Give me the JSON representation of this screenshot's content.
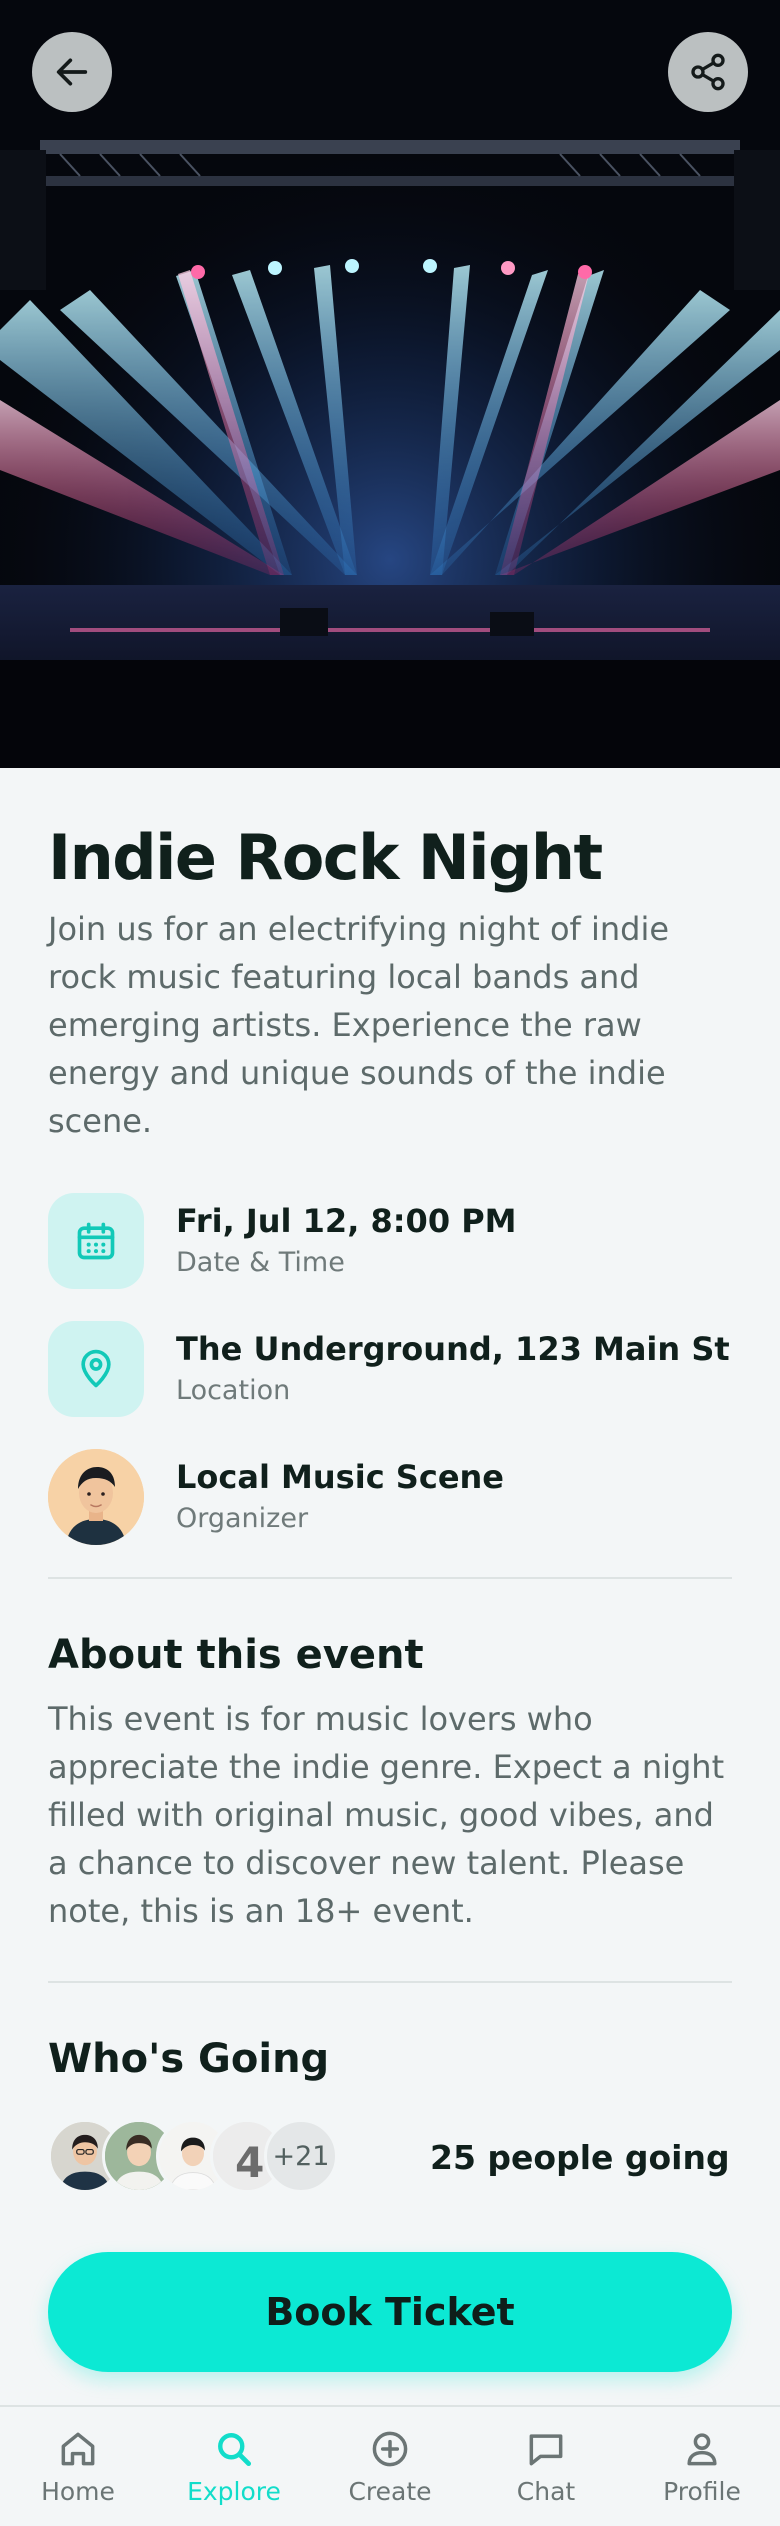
{
  "event": {
    "title": "Indie Rock Night",
    "description": "Join us for an electrifying night of indie rock music featuring local bands and emerging artists. Experience the raw energy and unique sounds of the indie scene."
  },
  "header": {
    "back_icon": "arrow-left-icon",
    "share_icon": "share-icon"
  },
  "details": [
    {
      "icon": "calendar-icon",
      "main": "Fri, Jul 12, 8:00 PM",
      "sub": "Date & Time"
    },
    {
      "icon": "map-pin-icon",
      "main": "The Underground, 123 Main St",
      "sub": "Location"
    },
    {
      "icon": "organizer-avatar",
      "main": "Local Music Scene",
      "sub": "Organizer"
    }
  ],
  "about": {
    "heading": "About this event",
    "text": "This event is for music lovers who appreciate the indie genre. Expect a night filled with original music, good vibes, and a chance to discover new talent. Please note, this is an 18+ event."
  },
  "going": {
    "heading": "Who's Going",
    "more_badge": "+21",
    "count_label": "25 people going"
  },
  "cta": {
    "label": "Book Ticket"
  },
  "nav": [
    {
      "label": "Home",
      "icon": "home-icon",
      "active": false
    },
    {
      "label": "Explore",
      "icon": "search-icon",
      "active": true
    },
    {
      "label": "Create",
      "icon": "plus-circle-icon",
      "active": false
    },
    {
      "label": "Chat",
      "icon": "chat-icon",
      "active": false
    },
    {
      "label": "Profile",
      "icon": "user-icon",
      "active": false
    }
  ],
  "colors": {
    "accent": "#0ce9d4",
    "accent_text": "#12ddca",
    "icon_tile": "#cff3f1",
    "background": "#f3f6f7",
    "heading": "#10201c",
    "body_text": "#5d6a6a"
  }
}
